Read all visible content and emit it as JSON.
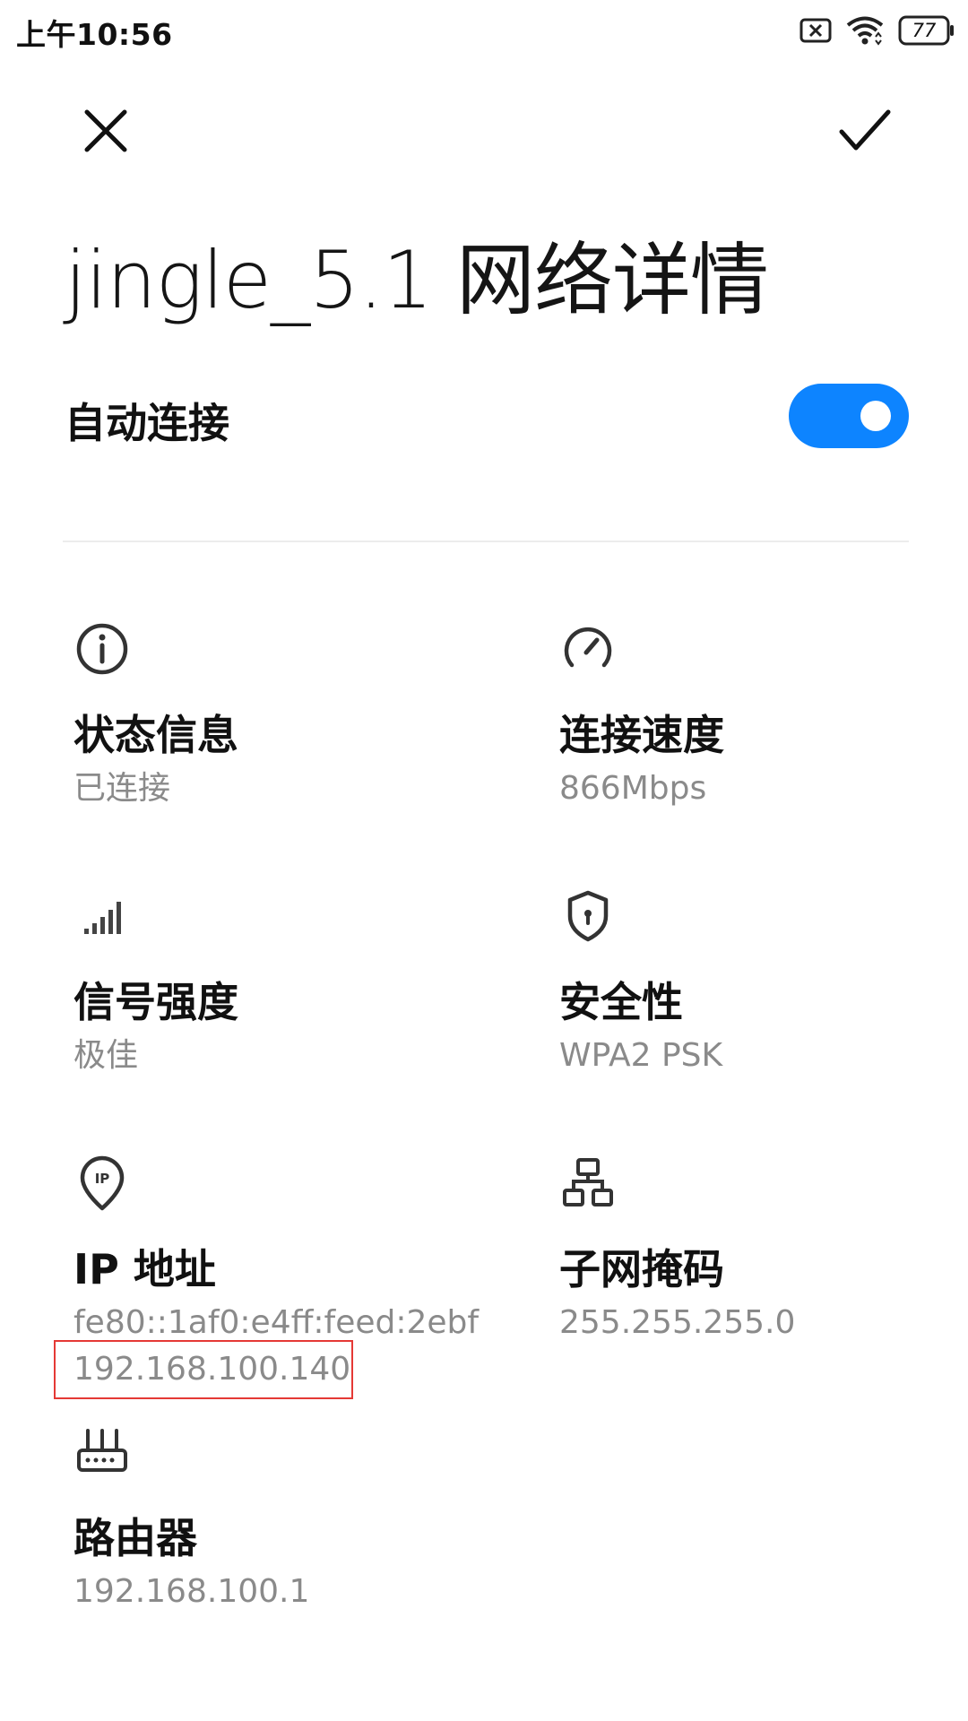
{
  "status_bar": {
    "time": "上午10:56",
    "battery_level": "77",
    "icons": [
      "sim-disabled-icon",
      "wifi-icon",
      "battery-icon"
    ]
  },
  "toolbar": {
    "close_icon": "close-icon",
    "confirm_icon": "check-icon"
  },
  "page": {
    "title": "jingle_5.1 网络详情"
  },
  "auto_connect": {
    "label": "自动连接",
    "enabled": true,
    "accent_color": "#0d84ff"
  },
  "details": {
    "status": {
      "icon": "info-icon",
      "title": "状态信息",
      "value": "已连接"
    },
    "speed": {
      "icon": "speedometer-icon",
      "title": "连接速度",
      "value": "866Mbps"
    },
    "signal": {
      "icon": "signal-bars-icon",
      "title": "信号强度",
      "value": "极佳"
    },
    "security": {
      "icon": "shield-lock-icon",
      "title": "安全性",
      "value": "WPA2 PSK"
    },
    "ip": {
      "icon": "ip-location-icon",
      "title": "IP 地址",
      "value_ipv6": "fe80::1af0:e4ff:feed:2ebf",
      "value_ipv4": "192.168.100.140"
    },
    "subnet": {
      "icon": "network-topology-icon",
      "title": "子网掩码",
      "value": "255.255.255.0"
    },
    "router": {
      "icon": "router-icon",
      "title": "路由器",
      "value": "192.168.100.1"
    }
  }
}
